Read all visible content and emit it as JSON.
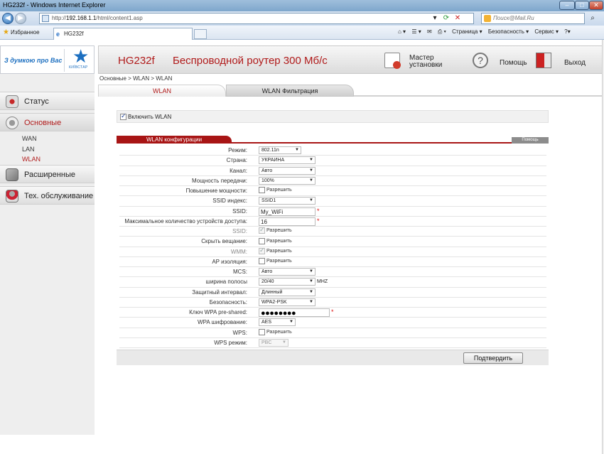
{
  "window": {
    "title": "HG232f - Windows Internet Explorer",
    "url_prefix": "http://",
    "url_host": "192.168.1.1",
    "url_path": "/html/content1.asp",
    "search_placeholder": "Поиск@Mail.Ru"
  },
  "favbar": {
    "favorites_label": "Избранное",
    "tab_title": "HG232f",
    "commands": [
      "Страница ▾",
      "Безопасность ▾",
      "Сервис ▾"
    ]
  },
  "logo": {
    "slogan": "З думкою про Вас",
    "brand": "КИЇВСТАР"
  },
  "header": {
    "model": "HG232f",
    "title": "Беспроводной роутер 300 Мб/с",
    "wizard_label_1": "Мастер",
    "wizard_label_2": "установки",
    "help_label": "Помощь",
    "exit_label": "Выход"
  },
  "breadcrumb": "Основные > WLAN > WLAN",
  "tabs": {
    "wlan": "WLAN",
    "filter": "WLAN Фильтрация"
  },
  "sidebar": {
    "status": "Статус",
    "basic": "Основные",
    "sub": [
      "WAN",
      "LAN",
      "WLAN"
    ],
    "advanced": "Расширенные",
    "maintenance": "Тех. обслуживание"
  },
  "enable_wlan": {
    "label": "Включить WLAN",
    "checked": true
  },
  "config": {
    "title": "WLAN конфигурации",
    "help": "Помощь",
    "allow": "Разрешить",
    "mhz": "MHZ",
    "mode_label": "Режим:",
    "mode_value": "802.11n",
    "country_label": "Страна:",
    "country_value": "УКРАИНА",
    "channel_label": "Канал:",
    "channel_value": "Авто",
    "power_label": "Мощность передачи:",
    "power_value": "100%",
    "boost_label": "Повышение мощности:",
    "ssid_index_label": "SSID индекс:",
    "ssid_index_value": "SSID1",
    "ssid_label": "SSID:",
    "ssid_value": "My_WiFi",
    "max_devices_label": "Максимальное количество устройств доступа:",
    "max_devices_value": "16",
    "ssid_enable_label": "SSID:",
    "hide_label": "Скрыть вещание:",
    "wmm_label": "WMM:",
    "ap_isolation_label": "AP изоляция:",
    "mcs_label": "MCS:",
    "mcs_value": "Авто",
    "bandwidth_label": "ширина полосы",
    "bandwidth_value": "20/40",
    "guard_label": "Защитный интервал:",
    "guard_value": "Длинный",
    "security_label": "Безопасность:",
    "security_value": "WPA2-PSK",
    "psk_label": "Ключ WPA pre-shared:",
    "psk_value": "●●●●●●●●",
    "encryption_label": "WPA шифрование:",
    "encryption_value": "AES",
    "wps_label": "WPS:",
    "wps_mode_label": "WPS режим:",
    "wps_mode_value": "PBC",
    "required_mark": "*"
  },
  "submit_label": "Подтвердить",
  "colors": {
    "accent": "#b01a1a",
    "cfg_bar": "#a81515",
    "sidebar_bg": "#eeeeee"
  }
}
